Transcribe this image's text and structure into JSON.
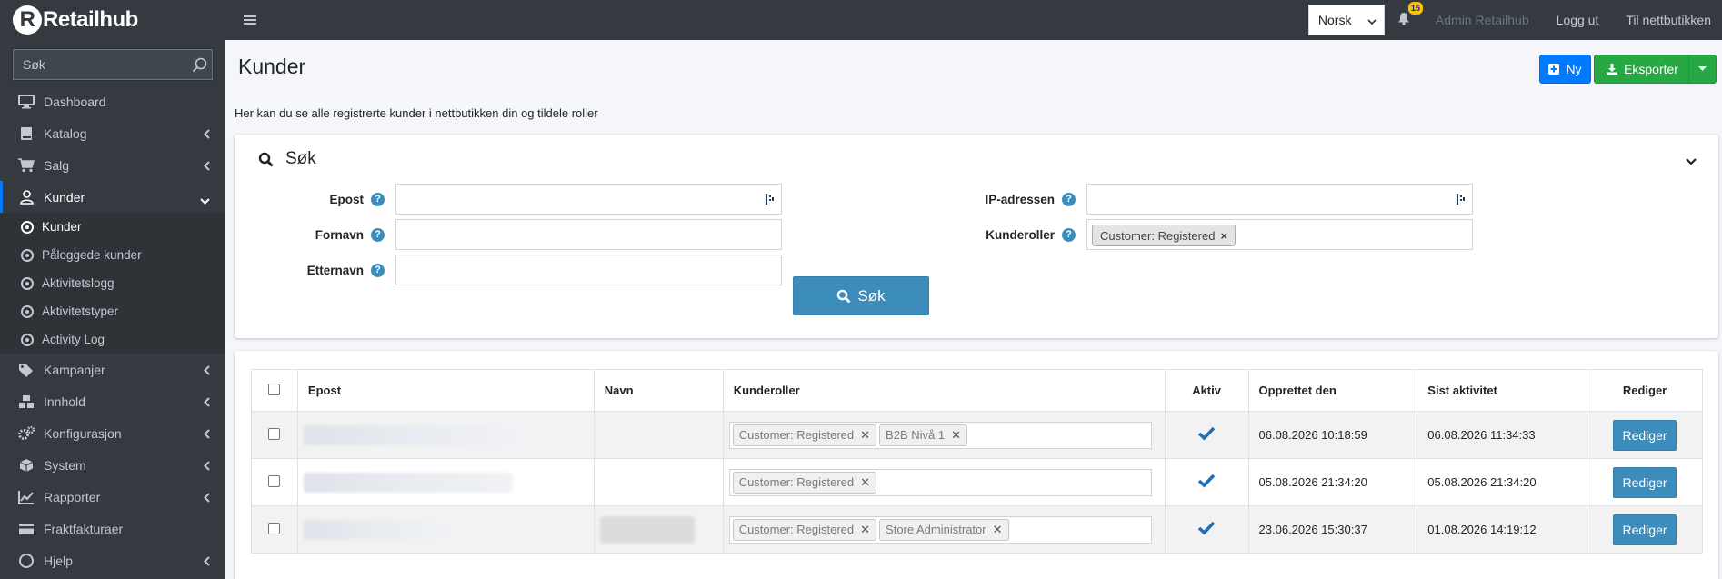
{
  "brand": {
    "name": "Retailhub"
  },
  "sidebar": {
    "search_placeholder": "Søk",
    "items": [
      {
        "label": "Dashboard",
        "icon": "monitor-icon"
      },
      {
        "label": "Katalog",
        "icon": "book-icon"
      },
      {
        "label": "Salg",
        "icon": "cart-icon"
      },
      {
        "label": "Kunder",
        "icon": "user-icon"
      },
      {
        "label": "Kampanjer",
        "icon": "tags-icon"
      },
      {
        "label": "Innhold",
        "icon": "cubes-icon"
      },
      {
        "label": "Konfigurasjon",
        "icon": "gears-icon"
      },
      {
        "label": "System",
        "icon": "cube-icon"
      },
      {
        "label": "Rapporter",
        "icon": "chart-icon"
      },
      {
        "label": "Fraktfakturaer",
        "icon": "invoice-icon"
      },
      {
        "label": "Hjelp",
        "icon": "help-icon"
      }
    ],
    "subitems": [
      {
        "label": "Kunder"
      },
      {
        "label": "Påloggede kunder"
      },
      {
        "label": "Aktivitetslogg"
      },
      {
        "label": "Aktivitetstyper"
      },
      {
        "label": "Activity Log"
      }
    ]
  },
  "topbar": {
    "language": "Norsk",
    "notification_count": "15",
    "user": "Admin Retailhub",
    "logout": "Logg ut",
    "store_link": "Til nettbutikken"
  },
  "page": {
    "title": "Kunder",
    "description": "Her kan du se alle registrerte kunder i nettbutikken din og tildele roller",
    "new_button": "Ny",
    "export_button": "Eksporter"
  },
  "search": {
    "title": "Søk",
    "fields": {
      "email": "Epost",
      "firstname": "Fornavn",
      "lastname": "Etternavn",
      "ip": "IP-adressen",
      "roles": "Kunderoller"
    },
    "roles_selected": "Customer: Registered",
    "button": "Søk"
  },
  "table": {
    "headers": {
      "email": "Epost",
      "name": "Navn",
      "roles": "Kunderoller",
      "active": "Aktiv",
      "created": "Opprettet den",
      "last_activity": "Sist aktivitet",
      "edit": "Rediger"
    },
    "rows": [
      {
        "roles": [
          "Customer: Registered",
          "B2B Nivå 1"
        ],
        "created": "06.08.2026 10:18:59",
        "last_activity": "06.08.2026 11:34:33",
        "edit": "Rediger"
      },
      {
        "roles": [
          "Customer: Registered"
        ],
        "created": "05.08.2026 21:34:20",
        "last_activity": "05.08.2026 21:34:20",
        "edit": "Rediger"
      },
      {
        "roles": [
          "Customer: Registered",
          "Store Administrator"
        ],
        "created": "23.06.2026 15:30:37",
        "last_activity": "01.08.2026 14:19:12",
        "edit": "Rediger"
      }
    ]
  },
  "colors": {
    "sidebar_bg": "#343a40",
    "primary": "#007bff",
    "success": "#28a745",
    "info": "#3c8dbc",
    "badge": "#ffc107"
  }
}
